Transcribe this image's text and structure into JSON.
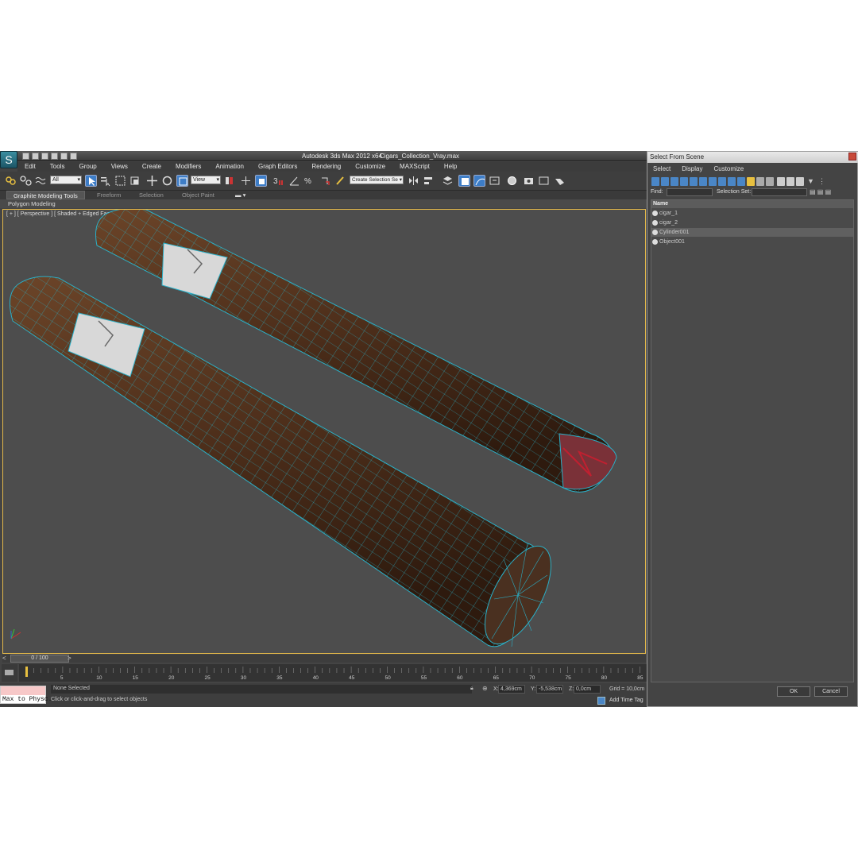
{
  "app": {
    "title": "Autodesk 3ds Max  2012 x64",
    "file": "Cigars_Collection_Vray.max",
    "logo_icon": "3ds-max-logo-icon"
  },
  "menu": [
    "Edit",
    "Tools",
    "Group",
    "Views",
    "Create",
    "Modifiers",
    "Animation",
    "Graph Editors",
    "Rendering",
    "Customize",
    "MAXScript",
    "Help"
  ],
  "toolbar": {
    "selection_filter": "All",
    "ref_coord": "View",
    "named_selection": "Create Selection Se"
  },
  "ribbon": {
    "tabs": [
      "Graphite Modeling Tools",
      "Freeform",
      "Selection",
      "Object Paint"
    ],
    "panel": "Polygon Modeling"
  },
  "viewport": {
    "label": "[ + ] [ Perspective ] [ Shaded + Edged Faces ]"
  },
  "timeslider": {
    "left": "<",
    "position": "0 / 100",
    "right": ">"
  },
  "trackbar": {
    "ticks": [
      "5",
      "10",
      "15",
      "20",
      "25",
      "30",
      "35",
      "40",
      "45",
      "50",
      "55",
      "60",
      "65",
      "70",
      "75",
      "80",
      "85"
    ]
  },
  "status": {
    "maxscript": "Max to Physc.",
    "selection": "None Selected",
    "prompt": "Click or click-and-drag to select objects",
    "x_label": "X:",
    "x_value": "4,369cm",
    "y_label": "Y:",
    "y_value": "-5,538cm",
    "z_label": "Z:",
    "z_value": "0,0cm",
    "grid": "Grid = 10,0cm",
    "add_time_tag": "Add Time Tag"
  },
  "dialog": {
    "title": "Select From Scene",
    "menu": [
      "Select",
      "Display",
      "Customize"
    ],
    "find_label": "Find:",
    "selection_set_label": "Selection Set:",
    "column": "Name",
    "items": [
      "cigar_1",
      "cigar_2",
      "Cylinder001",
      "Object001"
    ],
    "selected_index": 2,
    "ok": "OK",
    "cancel": "Cancel"
  }
}
